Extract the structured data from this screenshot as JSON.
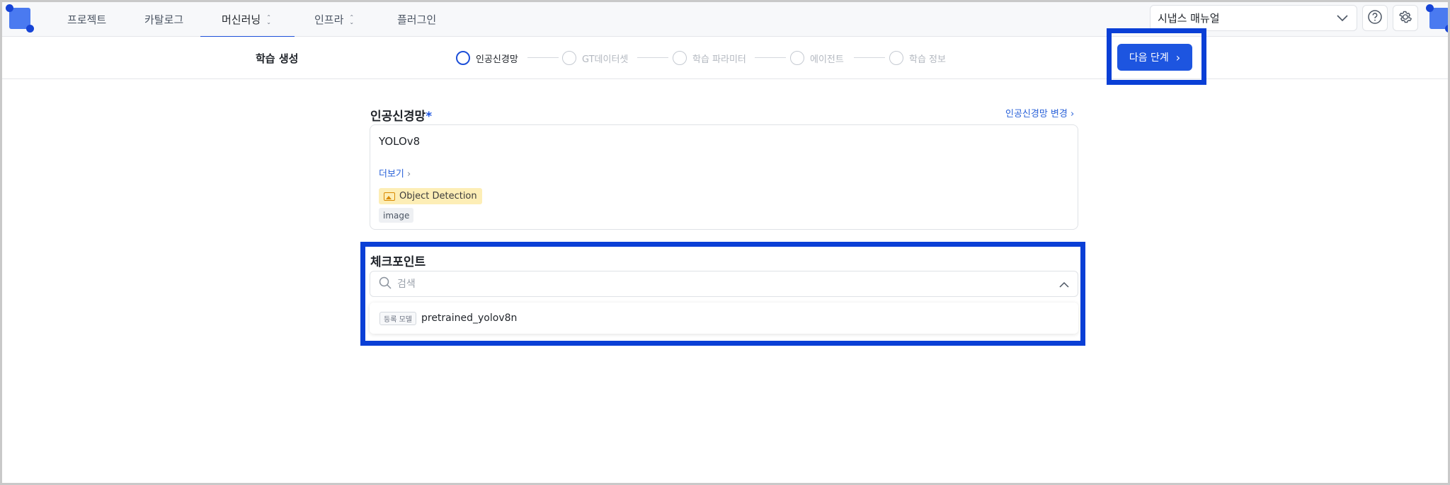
{
  "nav": {
    "items": [
      {
        "label": "프로젝트"
      },
      {
        "label": "카탈로그"
      },
      {
        "label": "머신러닝"
      },
      {
        "label": "인프라"
      },
      {
        "label": "플러그인"
      }
    ],
    "manual_select": "시냅스 매뉴얼"
  },
  "subheader": {
    "title": "학습 생성",
    "steps": [
      {
        "label": "인공신경망",
        "state": "active"
      },
      {
        "label": "GT데이터셋",
        "state": "inactive"
      },
      {
        "label": "학습 파라미터",
        "state": "inactive"
      },
      {
        "label": "에이전트",
        "state": "inactive"
      },
      {
        "label": "학습 정보",
        "state": "inactive"
      }
    ],
    "next_button": "다음 단계"
  },
  "network": {
    "label": "인공신경망",
    "required_mark": "*",
    "change_link": "인공신경망 변경",
    "model_name": "YOLOv8",
    "more_link": "더보기",
    "task_badge": "Object Detection",
    "type_badge": "image"
  },
  "checkpoint": {
    "label": "체크포인트",
    "search_placeholder": "검색",
    "options": [
      {
        "tag": "등록 모델",
        "name": "pretrained_yolov8n"
      }
    ]
  },
  "colors": {
    "accent": "#1d55e0",
    "highlight": "#0a3fd6",
    "badge_yellow": "#fdeeb6"
  }
}
